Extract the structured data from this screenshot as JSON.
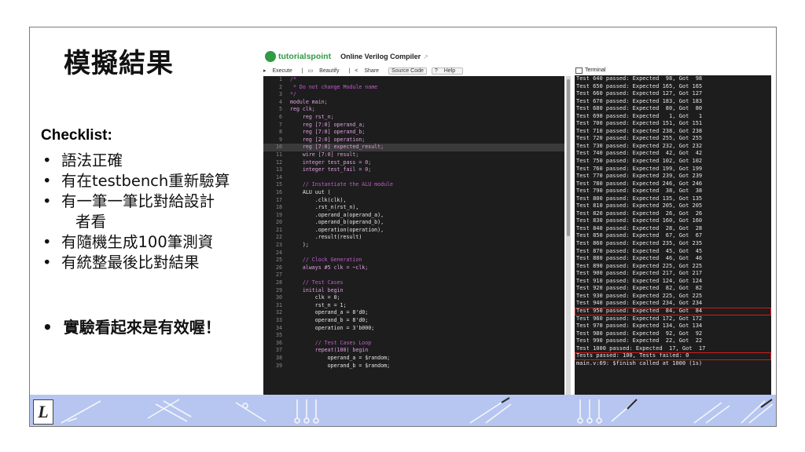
{
  "slide": {
    "title": "模擬結果",
    "checklist_heading": "Checklist:",
    "checklist_items": [
      "語法正確",
      "有在testbench重新驗算",
      "有一筆一筆比對給設計",
      "者看",
      "有隨機生成100筆測資",
      "有統整最後比對結果"
    ],
    "conclusion": "實驗看起來是有效喔！",
    "bullet": "•"
  },
  "app": {
    "brand": "tutorialspoint",
    "title": "Online Verilog Compiler",
    "toolbar": {
      "execute": "Execute",
      "beautify": "Beautify",
      "share": "Share",
      "source_code": "Source Code",
      "help": "Help"
    },
    "terminal_label": "Terminal"
  },
  "code_lines": [
    {
      "n": "1",
      "t": "/*",
      "c": "#c45bd0"
    },
    {
      "n": "2",
      "t": " * Do not change Module name",
      "c": "#c45bd0"
    },
    {
      "n": "3",
      "t": "*/",
      "c": "#c45bd0"
    },
    {
      "n": "4",
      "t": "module main;",
      "c": "#e0a0e0"
    },
    {
      "n": "5",
      "t": "reg clk;",
      "c": "#e0a0e0"
    },
    {
      "n": "6",
      "t": "    reg rst_n;",
      "c": "#e0a0e0"
    },
    {
      "n": "7",
      "t": "    reg [7:0] operand_a;",
      "c": "#e0a0e0"
    },
    {
      "n": "8",
      "t": "    reg [7:0] operand_b;",
      "c": "#e0a0e0"
    },
    {
      "n": "9",
      "t": "    reg [2:0] operation;",
      "c": "#e0a0e0"
    },
    {
      "n": "10",
      "t": "    reg [7:0] expected_result;",
      "c": "#e0a0e0",
      "hl": true
    },
    {
      "n": "11",
      "t": "    wire [7:0] result;",
      "c": "#e0a0e0"
    },
    {
      "n": "12",
      "t": "    integer test_pass = 0;",
      "c": "#e0a0e0"
    },
    {
      "n": "13",
      "t": "    integer test_fail = 0;",
      "c": "#e0a0e0"
    },
    {
      "n": "14",
      "t": "",
      "c": "#e0e0e0"
    },
    {
      "n": "15",
      "t": "    // Instantiate the ALU module",
      "c": "#c45bd0"
    },
    {
      "n": "16",
      "t": "    ALU uut (",
      "c": "#e8e8e8"
    },
    {
      "n": "17",
      "t": "        .clk(clk),",
      "c": "#e8e8e8"
    },
    {
      "n": "18",
      "t": "        .rst_n(rst_n),",
      "c": "#e8e8e8"
    },
    {
      "n": "19",
      "t": "        .operand_a(operand_a),",
      "c": "#e8e8e8"
    },
    {
      "n": "20",
      "t": "        .operand_b(operand_b),",
      "c": "#e8e8e8"
    },
    {
      "n": "21",
      "t": "        .operation(operation),",
      "c": "#e8e8e8"
    },
    {
      "n": "22",
      "t": "        .result(result)",
      "c": "#e8e8e8"
    },
    {
      "n": "23",
      "t": "    );",
      "c": "#e8e8e8"
    },
    {
      "n": "24",
      "t": "",
      "c": "#e0e0e0"
    },
    {
      "n": "25",
      "t": "    // Clock Generation",
      "c": "#c45bd0"
    },
    {
      "n": "26",
      "t": "    always #5 clk = ~clk;",
      "c": "#e0a0e0"
    },
    {
      "n": "27",
      "t": "",
      "c": "#e0e0e0"
    },
    {
      "n": "28",
      "t": "    // Test Cases",
      "c": "#c45bd0"
    },
    {
      "n": "29",
      "t": "    initial begin",
      "c": "#e0a0e0"
    },
    {
      "n": "30",
      "t": "        clk = 0;",
      "c": "#e8e8e8"
    },
    {
      "n": "31",
      "t": "        rst_n = 1;",
      "c": "#e8e8e8"
    },
    {
      "n": "32",
      "t": "        operand_a = 8'd0;",
      "c": "#e8e8e8"
    },
    {
      "n": "33",
      "t": "        operand_b = 8'd0;",
      "c": "#e8e8e8"
    },
    {
      "n": "34",
      "t": "        operation = 3'b000;",
      "c": "#e8e8e8"
    },
    {
      "n": "35",
      "t": "",
      "c": "#e0e0e0"
    },
    {
      "n": "36",
      "t": "        // Test Cases Loop",
      "c": "#c45bd0"
    },
    {
      "n": "37",
      "t": "        repeat(100) begin",
      "c": "#e0a0e0"
    },
    {
      "n": "38",
      "t": "            operand_a = $random;",
      "c": "#e8e8e8"
    },
    {
      "n": "39",
      "t": "            operand_b = $random;",
      "c": "#e8e8e8"
    }
  ],
  "terminal_lines": [
    "Test 640 passed: Expected  98, Got  98",
    "Test 650 passed: Expected 165, Got 165",
    "Test 660 passed: Expected 127, Got 127",
    "Test 670 passed: Expected 183, Got 183",
    "Test 680 passed: Expected  80, Got  80",
    "Test 690 passed: Expected   1, Got   1",
    "Test 700 passed: Expected 151, Got 151",
    "Test 710 passed: Expected 238, Got 238",
    "Test 720 passed: Expected 255, Got 255",
    "Test 730 passed: Expected 232, Got 232",
    "Test 740 passed: Expected  42, Got  42",
    "Test 750 passed: Expected 102, Got 102",
    "Test 760 passed: Expected 199, Got 199",
    "Test 770 passed: Expected 239, Got 239",
    "Test 780 passed: Expected 246, Got 246",
    "Test 790 passed: Expected  38, Got  38",
    "Test 800 passed: Expected 135, Got 135",
    "Test 810 passed: Expected 205, Got 205",
    "Test 820 passed: Expected  26, Got  26",
    "Test 830 passed: Expected 160, Got 160",
    "Test 840 passed: Expected  28, Got  28",
    "Test 850 passed: Expected  67, Got  67",
    "Test 860 passed: Expected 235, Got 235",
    "Test 870 passed: Expected  45, Got  45",
    "Test 880 passed: Expected  46, Got  46",
    "Test 890 passed: Expected 225, Got 225",
    "Test 900 passed: Expected 217, Got 217",
    "Test 910 passed: Expected 124, Got 124",
    "Test 920 passed: Expected  82, Got  82",
    "Test 930 passed: Expected 225, Got 225",
    "Test 940 passed: Expected 234, Got 234",
    "Test 950 passed: Expected  84, Got  84",
    "Test 960 passed: Expected 172, Got 172",
    "Test 970 passed: Expected 134, Got 134",
    "Test 980 passed: Expected  92, Got  92",
    "Test 990 passed: Expected  22, Got  22",
    "Test 1000 passed: Expected  17, Got  17",
    "Tests passed: 100, Tests failed: 0",
    "main.v:69: $finish called at 1000 (1s)"
  ],
  "highlighted_terminal_lines": [
    31,
    37
  ],
  "colors": {
    "editor_bg": "#1d1d1d",
    "footer_bg": "#b7c6f0",
    "brand_green": "#2f9b43",
    "highlight_box": "#d21b1b"
  },
  "logo_letter": "L"
}
